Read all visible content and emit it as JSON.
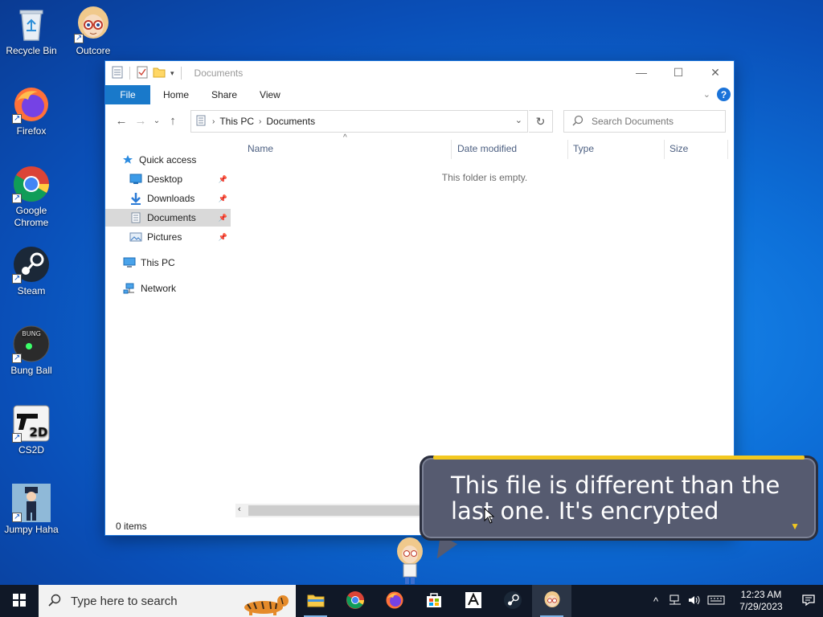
{
  "desktop": {
    "icons": [
      {
        "label": "Recycle Bin"
      },
      {
        "label": "Outcore"
      },
      {
        "label": "Firefox"
      },
      {
        "label": "Google Chrome"
      },
      {
        "label": "Steam"
      },
      {
        "label": "Bung Ball"
      },
      {
        "label": "CS2D"
      },
      {
        "label": "Jumpy Haha"
      }
    ]
  },
  "explorer": {
    "title": "Documents",
    "ribbon_tabs": {
      "file": "File",
      "home": "Home",
      "share": "Share",
      "view": "View"
    },
    "breadcrumb": [
      "This PC",
      "Documents"
    ],
    "search_placeholder": "Search Documents",
    "nav": {
      "quick_access": "Quick access",
      "desktop": "Desktop",
      "downloads": "Downloads",
      "documents": "Documents",
      "pictures": "Pictures",
      "this_pc": "This PC",
      "network": "Network"
    },
    "columns": {
      "name": "Name",
      "date": "Date modified",
      "type": "Type",
      "size": "Size"
    },
    "empty_message": "This folder is empty.",
    "status": "0 items"
  },
  "dialog": {
    "text": "This file is different than the last one. It's encrypted"
  },
  "taskbar": {
    "search_placeholder": "Type here to search",
    "time": "12:23 AM",
    "date": "7/29/2023"
  },
  "colors": {
    "accent": "#1979ca",
    "dialog_bg": "#565b70",
    "dialog_trim": "#f3c81f"
  }
}
